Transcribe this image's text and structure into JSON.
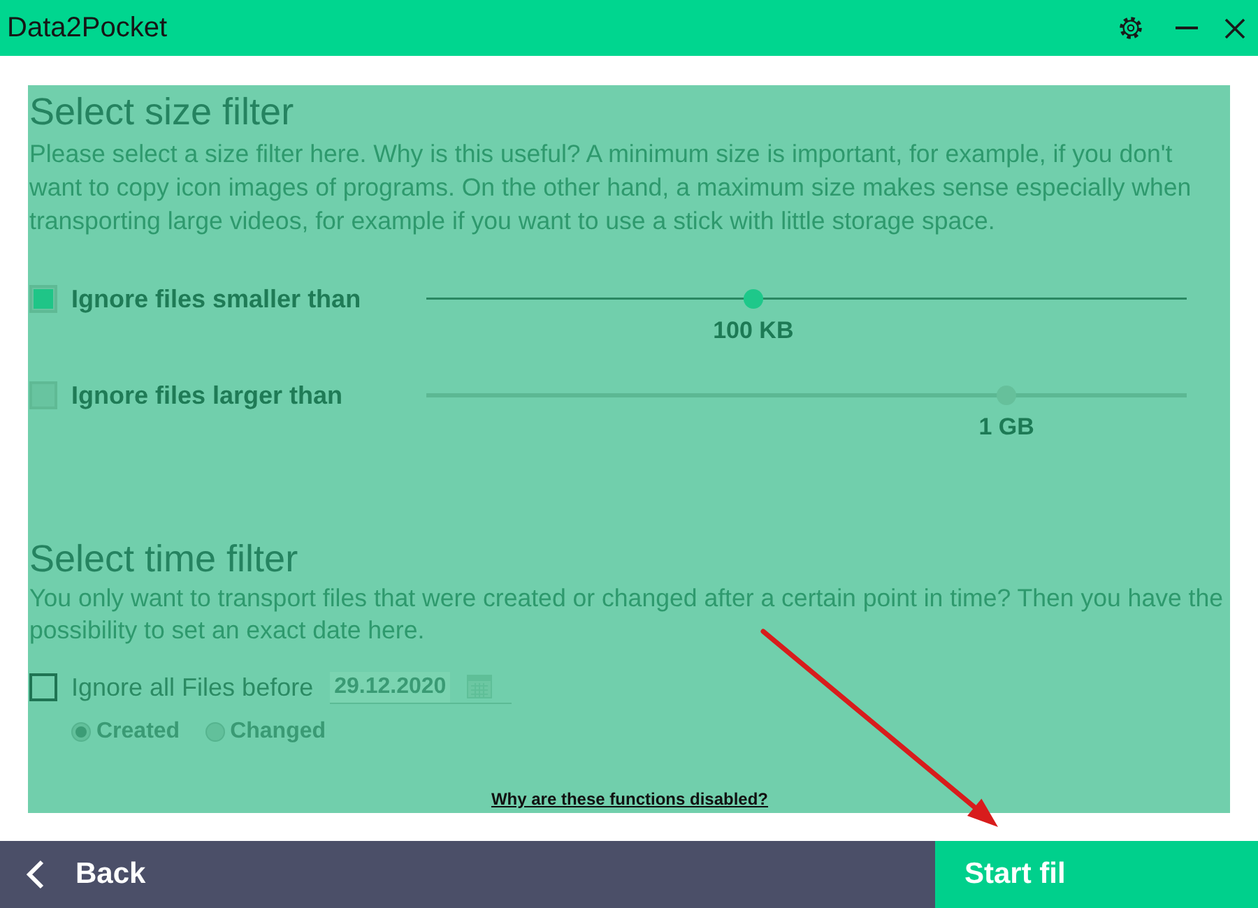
{
  "window": {
    "title": "Data2Pocket"
  },
  "size_filter": {
    "title": "Select size filter",
    "description": "Please select a size filter here. Why is this useful? A minimum size is important, for example, if you don't want to copy icon images of programs. On the other hand, a maximum size makes sense especially when transporting large videos, for example if you want to use a stick with little storage space.",
    "rows": [
      {
        "label": "Ignore files smaller than",
        "checked": true,
        "level": 0.43,
        "reading": "100 KB"
      },
      {
        "label": "Ignore files larger than",
        "checked": false,
        "level": 0.763,
        "reading": "1 GB"
      }
    ]
  },
  "time_filter": {
    "title": "Select time filter",
    "description": "You only want to transport files that were created or changed after a certain point in time? Then you have the possibility to set an exact date here.",
    "checkbox": {
      "label": "Ignore all Files before",
      "checked": false
    },
    "date_field": {
      "value": "29.12.2020"
    },
    "radios": [
      {
        "label": "Created",
        "selected": true
      },
      {
        "label": "Changed",
        "selected": false
      }
    ]
  },
  "help_link": "Why are these functions disabled?",
  "footer": {
    "back_button": "Back",
    "start_button": "Start fil"
  }
}
